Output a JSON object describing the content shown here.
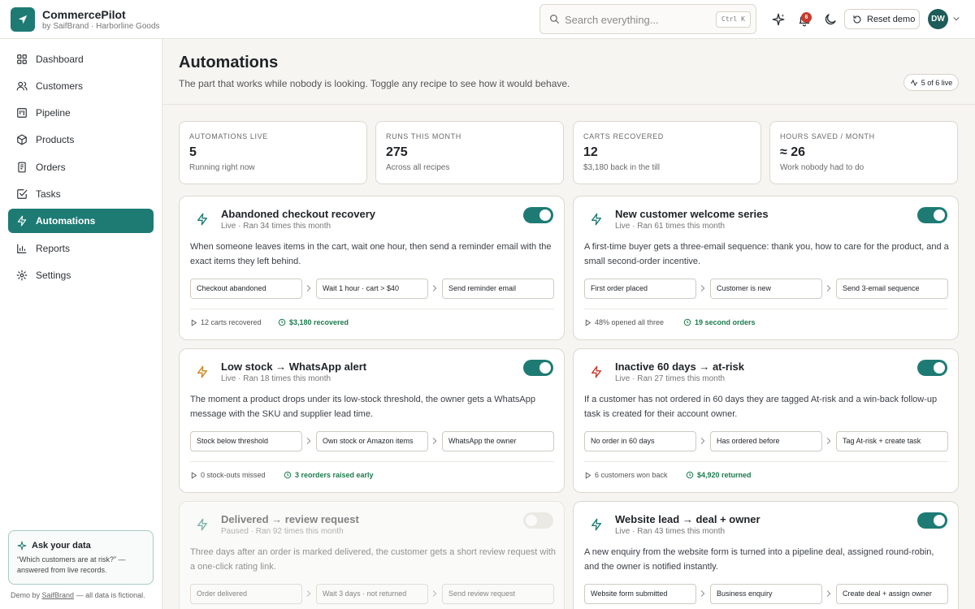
{
  "brand": {
    "title": "CommercePilot",
    "subtitle": "by SaifBrand · Harborline Goods"
  },
  "search": {
    "placeholder": "Search everything...",
    "shortcut": "Ctrl K"
  },
  "topbar": {
    "notification_count": "6",
    "reset_label": "Reset demo",
    "avatar_initials": "DW"
  },
  "sidebar": {
    "items": [
      {
        "label": "Dashboard",
        "icon": "grid-icon"
      },
      {
        "label": "Customers",
        "icon": "users-icon"
      },
      {
        "label": "Pipeline",
        "icon": "kanban-icon"
      },
      {
        "label": "Products",
        "icon": "box-icon"
      },
      {
        "label": "Orders",
        "icon": "document-icon"
      },
      {
        "label": "Tasks",
        "icon": "checkbox-icon"
      },
      {
        "label": "Automations",
        "icon": "bolt-icon",
        "active": true
      },
      {
        "label": "Reports",
        "icon": "bar-chart-icon"
      },
      {
        "label": "Settings",
        "icon": "gear-icon"
      }
    ],
    "ask": {
      "title": "Ask your data",
      "body": "“Which customers are at risk?” — answered from live records."
    },
    "footer": {
      "prefix": "Demo by",
      "brand": "SaifBrand",
      "suffix": "— all data is fictional."
    }
  },
  "header": {
    "title": "Automations",
    "subtitle": "The part that works while nobody is looking. Toggle any recipe to see how it would behave.",
    "live_pill": "5 of 6 live"
  },
  "stats": [
    {
      "label": "Automations live",
      "value": "5",
      "note": "Running right now"
    },
    {
      "label": "Runs this month",
      "value": "275",
      "note": "Across all recipes"
    },
    {
      "label": "Carts recovered",
      "value": "12",
      "note": "$3,180 back in the till"
    },
    {
      "label": "Hours saved / month",
      "value": "≈ 26",
      "note": "Work nobody had to do"
    }
  ],
  "automations": [
    {
      "title": "Abandoned checkout recovery",
      "meta": "Live · Ran 34 times this month",
      "enabled": true,
      "icon_color": "#1d7b74",
      "description": "When someone leaves items in the cart, wait one hour, then send a reminder email with the exact items they left behind.",
      "steps": [
        "Checkout abandoned",
        "Wait 1 hour · cart > $40",
        "Send reminder email"
      ],
      "stat1": "12 carts recovered",
      "stat2": "$3,180 recovered"
    },
    {
      "title": "New customer welcome series",
      "meta": "Live · Ran 61 times this month",
      "enabled": true,
      "icon_color": "#1d7b74",
      "description": "A first-time buyer gets a three-email sequence: thank you, how to care for the product, and a small second-order incentive.",
      "steps": [
        "First order placed",
        "Customer is new",
        "Send 3-email sequence"
      ],
      "stat1": "48% opened all three",
      "stat2": "19 second orders"
    },
    {
      "title": "Low stock → WhatsApp alert",
      "meta": "Live · Ran 18 times this month",
      "enabled": true,
      "icon_color": "#c9871e",
      "description": "The moment a product drops under its low-stock threshold, the owner gets a WhatsApp message with the SKU and supplier lead time.",
      "steps": [
        "Stock below threshold",
        "Own stock or Amazon items",
        "WhatsApp the owner"
      ],
      "stat1": "0 stock-outs missed",
      "stat2": "3 reorders raised early"
    },
    {
      "title": "Inactive 60 days → at-risk",
      "meta": "Live · Ran 27 times this month",
      "enabled": true,
      "icon_color": "#c53b2e",
      "description": "If a customer has not ordered in 60 days they are tagged At-risk and a win-back follow-up task is created for their account owner.",
      "steps": [
        "No order in 60 days",
        "Has ordered before",
        "Tag At-risk + create task"
      ],
      "stat1": "6 customers won back",
      "stat2": "$4,920 returned"
    },
    {
      "title": "Delivered → review request",
      "meta": "Paused · Ran 92 times this month",
      "enabled": false,
      "icon_color": "#1d7b74",
      "description": "Three days after an order is marked delivered, the customer gets a short review request with a one-click rating link.",
      "steps": [
        "Order delivered",
        "Wait 3 days · not returned",
        "Send review request"
      ],
      "stat1": "",
      "stat2": ""
    },
    {
      "title": "Website lead → deal + owner",
      "meta": "Live · Ran 43 times this month",
      "enabled": true,
      "icon_color": "#1d7b74",
      "description": "A new enquiry from the website form is turned into a pipeline deal, assigned round-robin, and the owner is notified instantly.",
      "steps": [
        "Website form submitted",
        "Business enquiry",
        "Create deal + assign owner"
      ],
      "stat1": "",
      "stat2": ""
    }
  ]
}
